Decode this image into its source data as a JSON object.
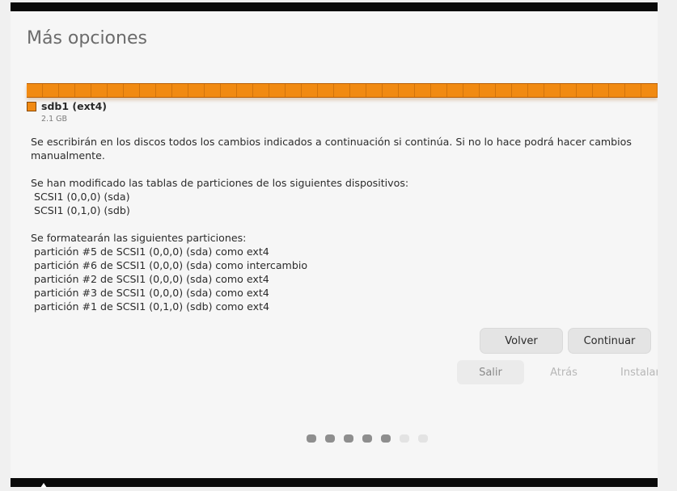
{
  "window": {
    "title": "Más opciones"
  },
  "partition": {
    "label": "sdb1 (ext4)",
    "size": "2.1 GB",
    "color": "#f18a12",
    "fill_fraction": 1.0
  },
  "message": {
    "intro_line1": "Se escribirán en los discos todos los cambios indicados a continuación si continúa. Si no lo hace podrá hacer cambios",
    "intro_line2": "manualmente.",
    "tables_heading": "Se han modificado las tablas de particiones de los siguientes dispositivos:",
    "devices": [
      " SCSI1 (0,0,0) (sda)",
      " SCSI1 (0,1,0) (sdb)"
    ],
    "format_heading": "Se formatearán las siguientes particiones:",
    "partitions": [
      " partición #5 de SCSI1 (0,0,0) (sda) como ext4",
      " partición #6 de SCSI1 (0,0,0) (sda) como intercambio",
      " partición #2 de SCSI1 (0,0,0) (sda) como ext4",
      " partición #3 de SCSI1 (0,0,0) (sda) como ext4",
      " partición #1 de SCSI1 (0,1,0) (sdb) como ext4"
    ]
  },
  "dialog_buttons": {
    "back": "Volver",
    "continue": "Continuar"
  },
  "nav": {
    "quit": "Salir",
    "back": "Atrás",
    "install": "Instalar"
  },
  "progress": {
    "total_steps": 7,
    "completed_steps": 5
  }
}
